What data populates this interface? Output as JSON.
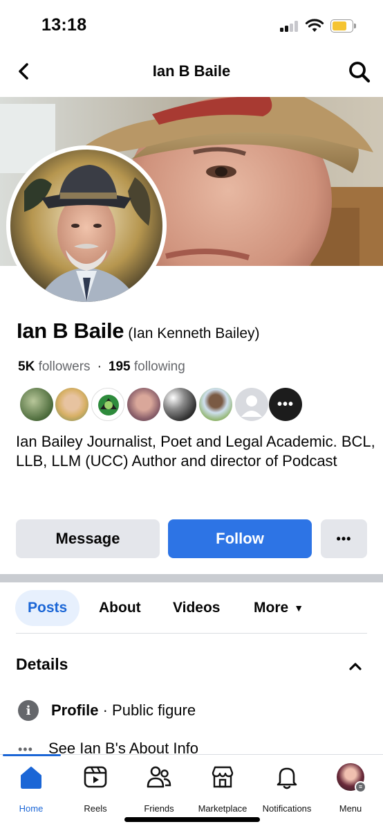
{
  "status_bar": {
    "time": "13:18"
  },
  "header": {
    "title": "Ian B Baile",
    "back_icon": "chevron-left-icon",
    "search_icon": "search-icon"
  },
  "profile": {
    "name": "Ian B Baile",
    "alternate_name": "(Ian Kenneth Bailey)",
    "followers_count": "5K",
    "followers_label": "followers",
    "following_count": "195",
    "following_label": "following",
    "stats_separator": "·",
    "bio": "Ian Bailey Journalist, Poet and Legal Academic. BCL, LLB, LLM (UCC) Author and director of Podcast"
  },
  "actions": {
    "message": "Message",
    "follow": "Follow",
    "more": "•••"
  },
  "tabs": [
    {
      "label": "Posts",
      "active": true
    },
    {
      "label": "About"
    },
    {
      "label": "Videos"
    },
    {
      "label": "More",
      "icon": "caret-down-icon"
    }
  ],
  "details": {
    "title": "Details",
    "profile_label": "Profile",
    "profile_value": "· Public figure",
    "about_link": "See Ian B's About Info"
  },
  "follower_faces_more": "•••",
  "bottom_nav": [
    {
      "label": "Home",
      "icon": "home-icon",
      "active": true
    },
    {
      "label": "Reels",
      "icon": "reels-icon"
    },
    {
      "label": "Friends",
      "icon": "friends-icon"
    },
    {
      "label": "Marketplace",
      "icon": "marketplace-icon"
    },
    {
      "label": "Notifications",
      "icon": "bell-icon"
    },
    {
      "label": "Menu",
      "icon": "avatar-icon"
    }
  ],
  "colors": {
    "accent": "#2d74e5",
    "active_tab_bg": "#e7f0fd",
    "battery": "#f5c431"
  }
}
